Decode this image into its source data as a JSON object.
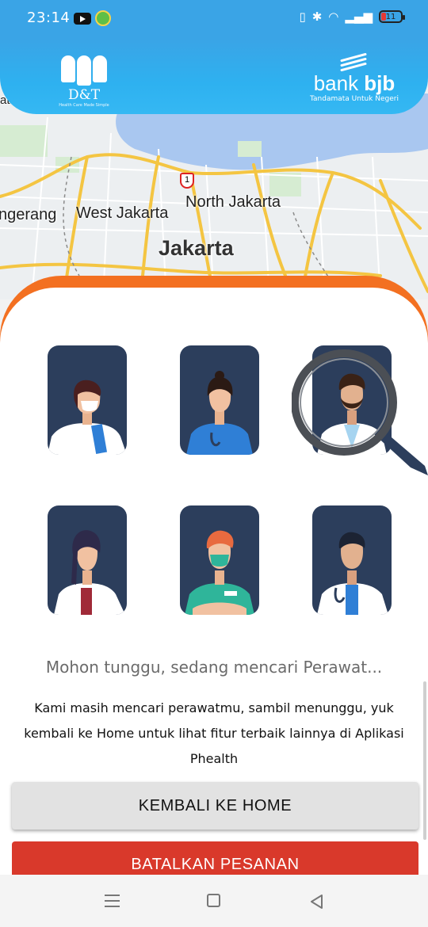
{
  "status_bar": {
    "time": "23:14",
    "battery_level": "11"
  },
  "map": {
    "labels": {
      "at": "at",
      "tangerang": "ngerang",
      "west_jakarta": "West Jakarta",
      "north_jakarta": "North Jakarta",
      "jakarta": "Jakarta"
    },
    "road_number": "1"
  },
  "header": {
    "left_logo_text": "D&T",
    "left_logo_tagline": "Health Care Made Simple",
    "right_logo_name_light": "bank ",
    "right_logo_name_bold": "bjb",
    "right_logo_tagline": "Tandamata Untuk Negeri"
  },
  "search": {
    "title": "Mohon tunggu, sedang mencari Perawat...",
    "message": "Kami masih mencari perawatmu, sambil menunggu, yuk kembali ke Home untuk lihat fitur terbaik lainnya di Aplikasi Phealth"
  },
  "buttons": {
    "home_label": "KEMBALI KE HOME",
    "cancel_label": "BATALKAN PESANAN"
  },
  "colors": {
    "header_blue": "#3aa4e6",
    "sheet_orange": "#f37021",
    "card_navy": "#2c3e5c",
    "cancel_red": "#d9392b"
  },
  "icons": [
    "youtube-icon",
    "app-notification-icon",
    "vibrate-icon",
    "bluetooth-icon",
    "wifi-icon",
    "signal-icon",
    "battery-icon",
    "magnifier-icon",
    "menu-icon",
    "home-icon",
    "back-icon"
  ]
}
